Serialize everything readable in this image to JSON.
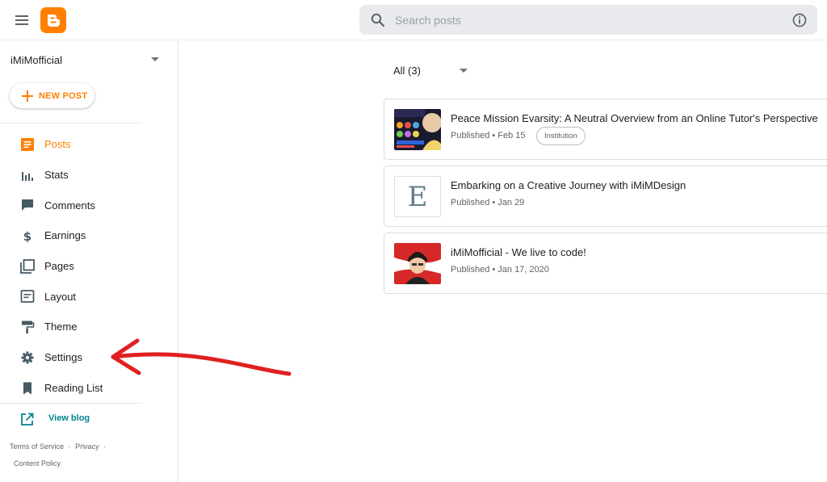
{
  "search": {
    "placeholder": "Search posts"
  },
  "sidebar": {
    "blog_name": "iMiMofficial",
    "new_post_label": "NEW POST",
    "items": [
      {
        "label": "Posts",
        "icon": "posts-icon",
        "active": true
      },
      {
        "label": "Stats",
        "icon": "stats-icon"
      },
      {
        "label": "Comments",
        "icon": "comments-icon"
      },
      {
        "label": "Earnings",
        "icon": "earnings-icon"
      },
      {
        "label": "Pages",
        "icon": "pages-icon"
      },
      {
        "label": "Layout",
        "icon": "layout-icon"
      },
      {
        "label": "Theme",
        "icon": "theme-icon"
      },
      {
        "label": "Settings",
        "icon": "settings-icon"
      },
      {
        "label": "Reading List",
        "icon": "reading-list-icon"
      }
    ],
    "view_blog": "View blog",
    "footer": {
      "terms": "Terms of Service",
      "privacy": "Privacy",
      "content_policy": "Content Policy",
      "separator": "·"
    }
  },
  "main": {
    "filter_label": "All (3)",
    "posts": [
      {
        "title": "Peace Mission Evarsity: A Neutral Overview from an Online Tutor's Perspective",
        "meta": "Published • Feb 15",
        "label": "Institution"
      },
      {
        "title": "Embarking on a Creative Journey with iMiMDesign",
        "meta": "Published • Jan 29",
        "thumb_letter": "E"
      },
      {
        "title": "iMiMofficial - We live to code!",
        "meta": "Published • Jan 17, 2020"
      }
    ]
  },
  "colors": {
    "accent": "#ff8000",
    "link": "#00838f",
    "annotation_arrow": "#e02020"
  }
}
